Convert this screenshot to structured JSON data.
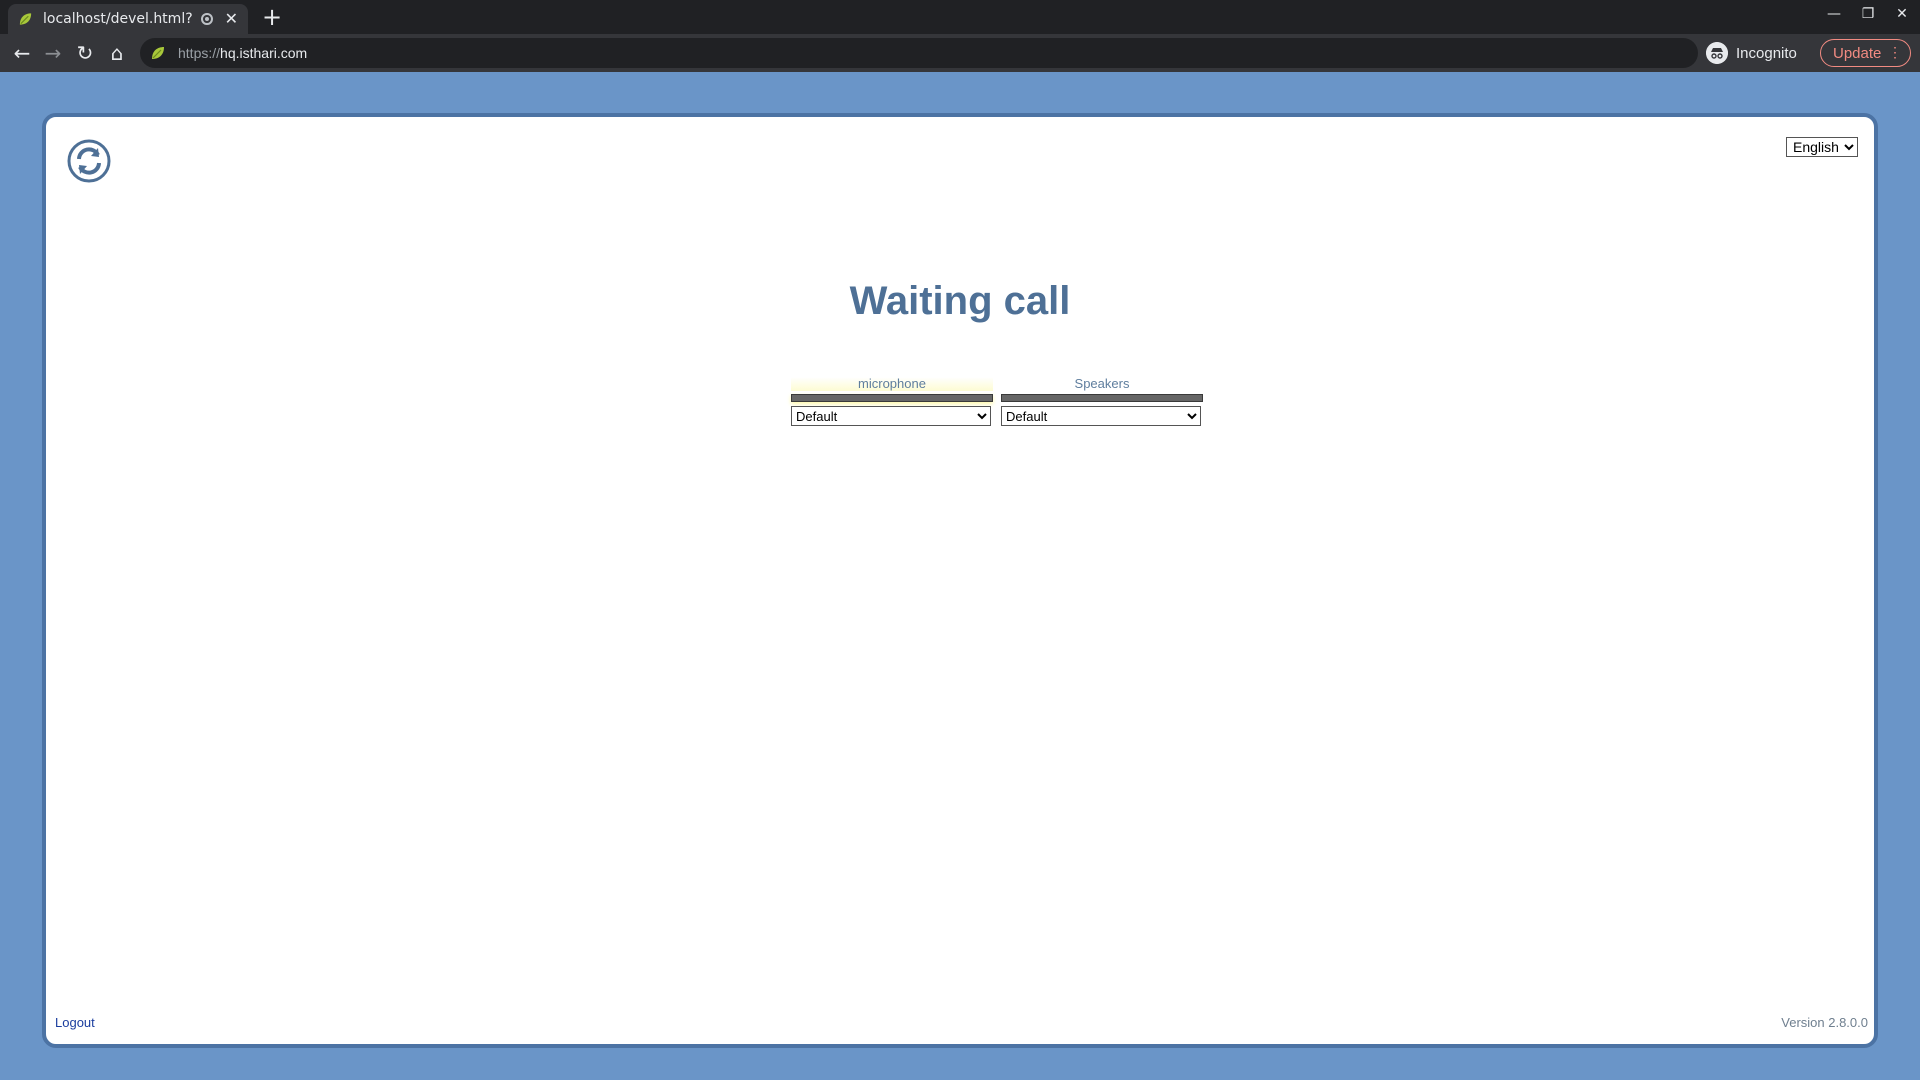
{
  "browser": {
    "tab": {
      "title": "localhost/devel.html?l",
      "close": "✕"
    },
    "new_tab": "+",
    "nav": {
      "back": "←",
      "forward": "→",
      "reload": "↻",
      "home": "⌂"
    },
    "address": {
      "scheme": "https://",
      "host": "hq.isthari.com"
    },
    "incognito_label": "Incognito",
    "update_label": "Update",
    "window_controls": {
      "minimize": "—",
      "restore": "❐",
      "close": "✕"
    }
  },
  "page": {
    "language": {
      "selected": "English",
      "options": [
        "English"
      ]
    },
    "title": "Waiting call",
    "microphone": {
      "label": "microphone",
      "selected": "Default",
      "level": 0
    },
    "speakers": {
      "label": "Speakers",
      "selected": "Default",
      "level": 0
    },
    "logout_label": "Logout",
    "version": "Version 2.8.0.0"
  },
  "colors": {
    "page_background": "#6a95c8",
    "frame_border": "#4c73a4",
    "title": "#4e7096",
    "update_accent": "#f28b82"
  },
  "icons": {
    "favicon": "leaf-icon",
    "sync": "sync-icon",
    "incognito": "incognito-icon"
  }
}
